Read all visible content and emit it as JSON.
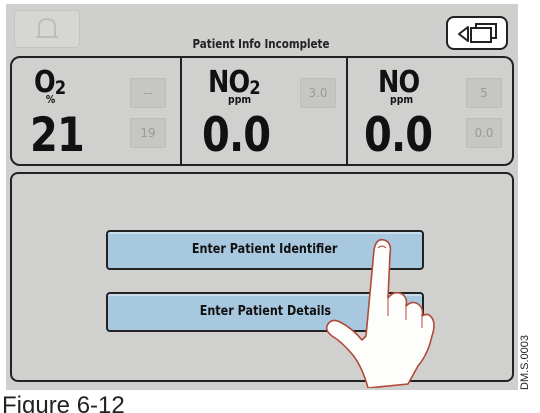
{
  "header": {
    "status_title": "Patient Info Incomplete",
    "alarm_icon": "bell-icon",
    "back_icon": "back-windows-icon"
  },
  "gases": {
    "o2": {
      "name_main": "O",
      "name_sub": "2",
      "unit": "%",
      "value": "21",
      "upper_limit": "--",
      "lower_limit": "19"
    },
    "no2": {
      "name_main": "NO",
      "name_sub": "2",
      "unit": "ppm",
      "value": "0.0",
      "upper_limit": "3.0"
    },
    "no": {
      "name_main": "NO",
      "unit": "ppm",
      "value": "0.0",
      "upper_limit": "5",
      "lower_limit": "0.0"
    }
  },
  "actions": {
    "enter_identifier": "Enter Patient Identifier",
    "enter_details": "Enter Patient Details"
  },
  "figure": {
    "caption": "Figure 6-12",
    "code": "DM.S.0003"
  },
  "colors": {
    "screen_bg": "#cfcfcd",
    "button_blue": "#a8c8e0",
    "border": "#222222"
  }
}
